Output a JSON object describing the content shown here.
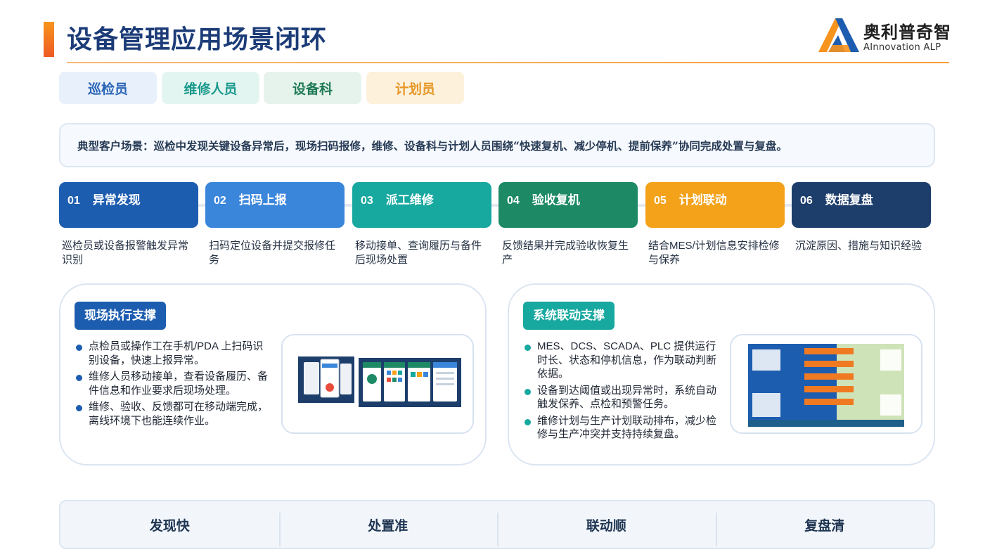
{
  "header": {
    "title": "设备管理应用场景闭环",
    "logo_cn": "奥利普奇智",
    "logo_en": "AInnovation ALP"
  },
  "roles": [
    "巡检员",
    "维修人员",
    "设备科",
    "计划员"
  ],
  "scenario": "典型客户场景：巡检中发现关键设备异常后，现场扫码报修，维修、设备科与计划人员围绕“快速复机、减少停机、提前保养”协同完成处置与复盘。",
  "steps": [
    {
      "num": "01",
      "title": "异常发现",
      "desc": "巡检员或设备报警触发异常识别"
    },
    {
      "num": "02",
      "title": "扫码上报",
      "desc": "扫码定位设备并提交报修任务"
    },
    {
      "num": "03",
      "title": "派工维修",
      "desc": "移动接单、查询履历与备件后现场处置"
    },
    {
      "num": "04",
      "title": "验收复机",
      "desc": "反馈结果并完成验收恢复生产"
    },
    {
      "num": "05",
      "title": "计划联动",
      "desc": "结合MES/计划信息安排检修与保养"
    },
    {
      "num": "06",
      "title": "数据复盘",
      "desc": "沉淀原因、措施与知识经验"
    }
  ],
  "panels": {
    "left": {
      "tag": "现场执行支撑",
      "bullets": [
        "点检员或操作工在手机/PDA 上扫码识别设备，快速上报异常。",
        "维修人员移动接单，查看设备履历、备件信息和作业要求后现场处理。",
        "维修、验收、反馈都可在移动端完成，离线环境下也能连续作业。"
      ]
    },
    "right": {
      "tag": "系统联动支撑",
      "bullets": [
        "MES、DCS、SCADA、PLC 提供运行时长、状态和停机信息，作为联动判断依据。",
        "设备到达阈值或出现异常时，系统自动触发保养、点检和预警任务。",
        "维修计划与生产计划联动排布，减少检修与生产冲突并支持持续复盘。"
      ]
    }
  },
  "summary": [
    "发现快",
    "处置准",
    "联动顺",
    "复盘清"
  ],
  "colors": {
    "brand_navy": "#1c3c78",
    "accent_orange": "#f7941d",
    "step_colors": [
      "#1d5db0",
      "#3a86db",
      "#17a8a0",
      "#1e8a65",
      "#f3a21a",
      "#1d3e6b"
    ]
  }
}
